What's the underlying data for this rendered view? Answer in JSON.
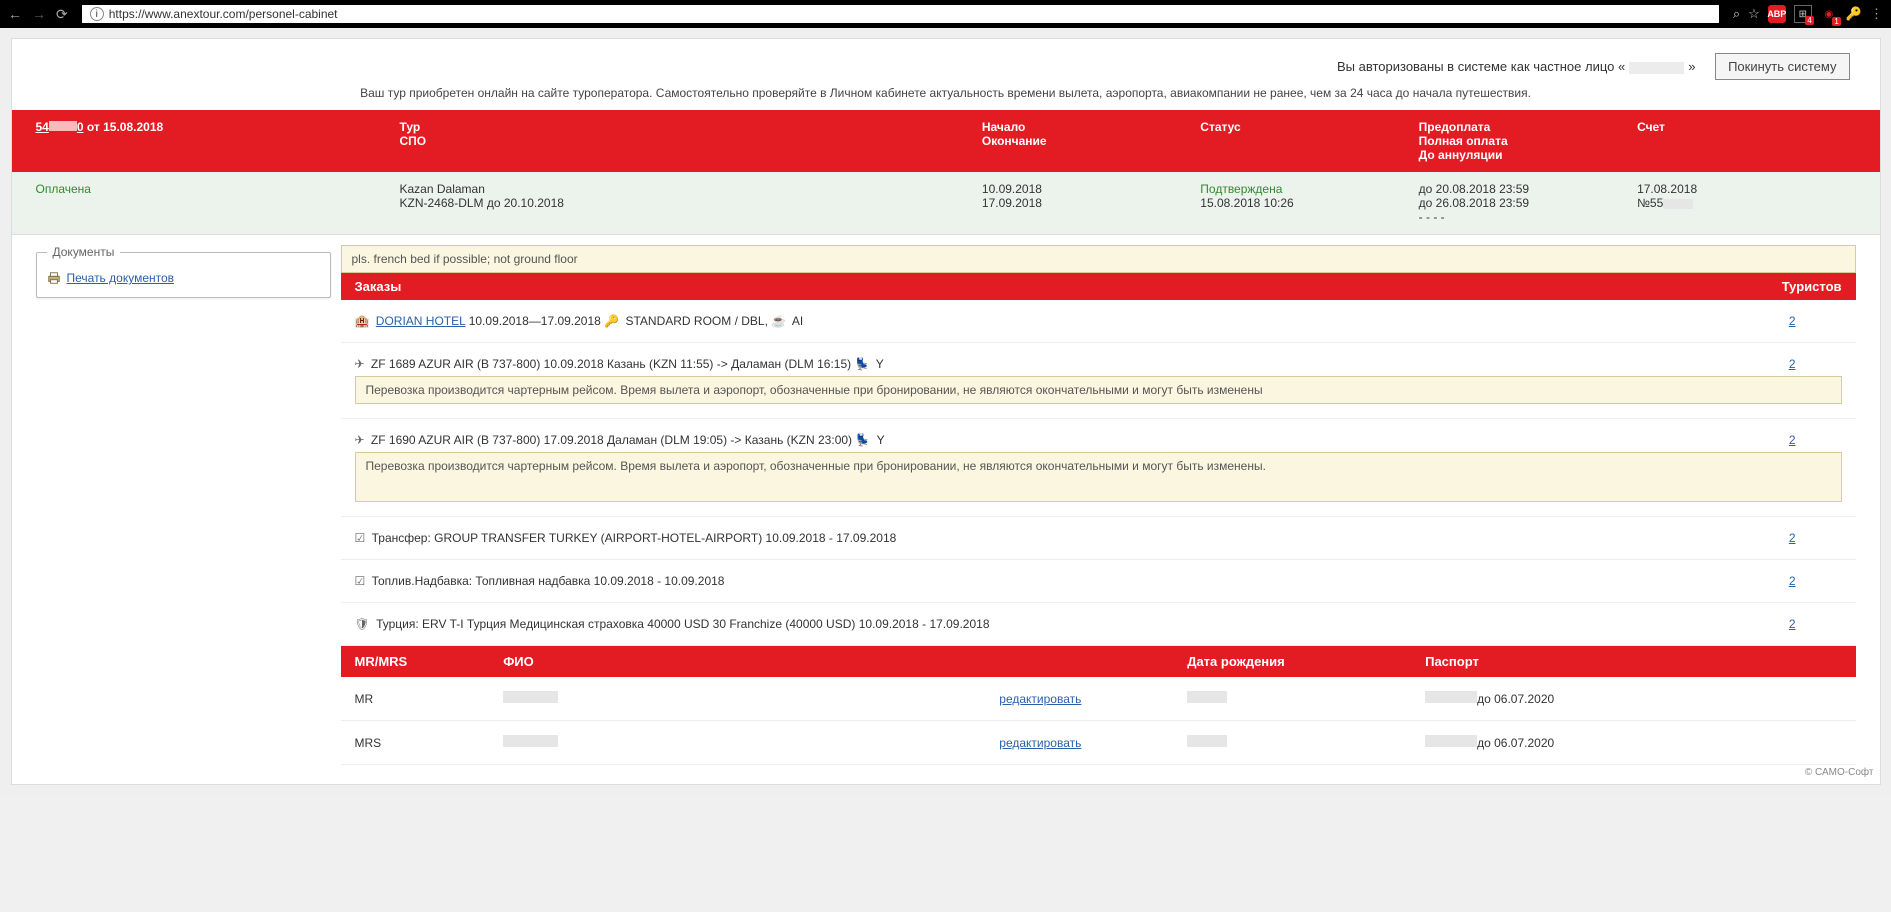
{
  "browser": {
    "url": "https://www.anextour.com/personel-cabinet"
  },
  "auth": {
    "prefix": "Вы авторизованы в системе как частное лицо «",
    "suffix": "»",
    "logout": "Покинуть систему"
  },
  "info_line": "Ваш тур приобретен онлайн на сайте туроператора. Самостоятельно проверяйте в Личном кабинете актуальность времени вылета, аэропорта, авиакомпании не ранее, чем за 24 часа до начала путешествия.",
  "header": {
    "order_prefix": "54",
    "order_suffix": "0",
    "order_date": " от 15.08.2018",
    "tour_l1": "Тур",
    "tour_l2": "СПО",
    "dates_l1": "Начало",
    "dates_l2": "Окончание",
    "status": "Статус",
    "pay_l1": "Предоплата",
    "pay_l2": "Полная оплата",
    "pay_l3": "До аннуляции",
    "invoice": "Счет"
  },
  "row": {
    "paid": "Оплачена",
    "tour_l1": "Kazan Dalaman",
    "tour_l2": "KZN-2468-DLM до 20.10.2018",
    "date_l1": "10.09.2018",
    "date_l2": "17.09.2018",
    "status_l1": "Подтверждена",
    "status_l2": "15.08.2018 10:26",
    "pay_l1": "до 20.08.2018 23:59",
    "pay_l2": "до 26.08.2018 23:59",
    "pay_l3": "- - - -",
    "inv_l1": "17.08.2018",
    "inv_l2": "№55"
  },
  "docs": {
    "title": "Документы",
    "print": "Печать документов"
  },
  "note": "pls. french bed if possible; not ground floor",
  "orders": {
    "title": "Заказы",
    "tourists": "Туристов",
    "hotel_name": "DORIAN HOTEL",
    "hotel_dates": " 10.09.2018—17.09.2018",
    "hotel_room": " STANDARD ROOM / DBL, ",
    "hotel_meal": " AI",
    "hotel_count": "2",
    "flight1": "ZF 1689 AZUR AIR (В 737-800) 10.09.2018 Казань (KZN 11:55) -> Даламан (DLM 16:15)",
    "flight1_class": " Y",
    "flight1_count": "2",
    "flight2": "ZF 1690 AZUR AIR (В 737-800) 17.09.2018 Даламан (DLM 19:05) -> Казань (KZN 23:00)",
    "flight2_class": " Y",
    "flight2_count": "2",
    "charter_note1": "Перевозка производится чартерным рейсом. Время вылета и аэропорт, обозначенные при бронировании, не являются окончательными и могут быть изменены",
    "charter_note2": "Перевозка производится чартерным рейсом. Время вылета и аэропорт, обозначенные при бронировании, не являются окончательными и могут быть изменены.",
    "transfer": "Трансфер: GROUP TRANSFER TURKEY (AIRPORT-HOTEL-AIRPORT) 10.09.2018 - 17.09.2018",
    "transfer_count": "2",
    "fuel": "Топлив.Надбавка: Топливная надбавка 10.09.2018 - 10.09.2018",
    "fuel_count": "2",
    "insurance": "Турция: ERV T-I Турция Медицинская страховка 40000 USD 30 Franchize (40000 USD) 10.09.2018 - 17.09.2018",
    "insurance_count": "2"
  },
  "tourists_hdr": {
    "mrmrs": "MR/MRS",
    "fio": "ФИО",
    "dob": "Дата рождения",
    "passport": "Паспорт"
  },
  "tourists": {
    "t1_title": "MR",
    "t1_edit": "редактировать",
    "t1_passport": "до 06.07.2020",
    "t2_title": "MRS",
    "t2_edit": "редактировать",
    "t2_passport": "до 06.07.2020"
  },
  "footer": "© САМО-Софт"
}
